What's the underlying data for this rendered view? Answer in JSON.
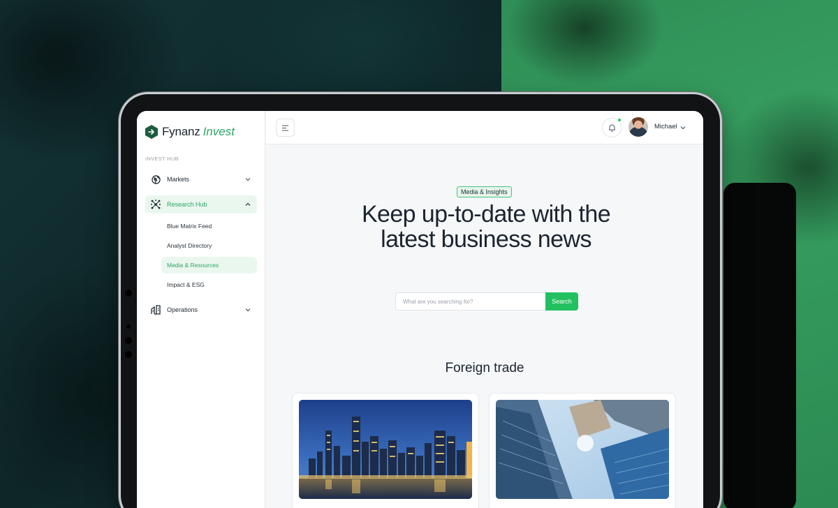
{
  "brand": {
    "name": "Fynanz",
    "accent": "Invest",
    "color": "#2fa565"
  },
  "sidebar": {
    "section_label": "INVEST HUB",
    "items": [
      {
        "label": "Markets",
        "icon": "globe-icon"
      },
      {
        "label": "Research Hub",
        "icon": "network-icon",
        "active": true,
        "children": [
          {
            "label": "Blue Matrix Feed"
          },
          {
            "label": "Analyst Directory"
          },
          {
            "label": "Media & Resources",
            "active": true
          },
          {
            "label": "Impact & ESG"
          }
        ]
      },
      {
        "label": "Operations",
        "icon": "buildings-icon"
      }
    ]
  },
  "topbar": {
    "user_name": "Michael",
    "notification_status": "new"
  },
  "main": {
    "badge": "Media & Insights",
    "hero_title": "Keep up-to-date with the latest business news",
    "search": {
      "placeholder": "What are you searching for?",
      "button": "Search"
    },
    "section_title": "Foreign trade",
    "cards": [
      {
        "image": "city-skyline-night"
      },
      {
        "image": "glass-skyscrapers"
      }
    ]
  },
  "colors": {
    "accent": "#22c05f",
    "accent_light": "#eaf7ef",
    "text": "#1b2430"
  }
}
